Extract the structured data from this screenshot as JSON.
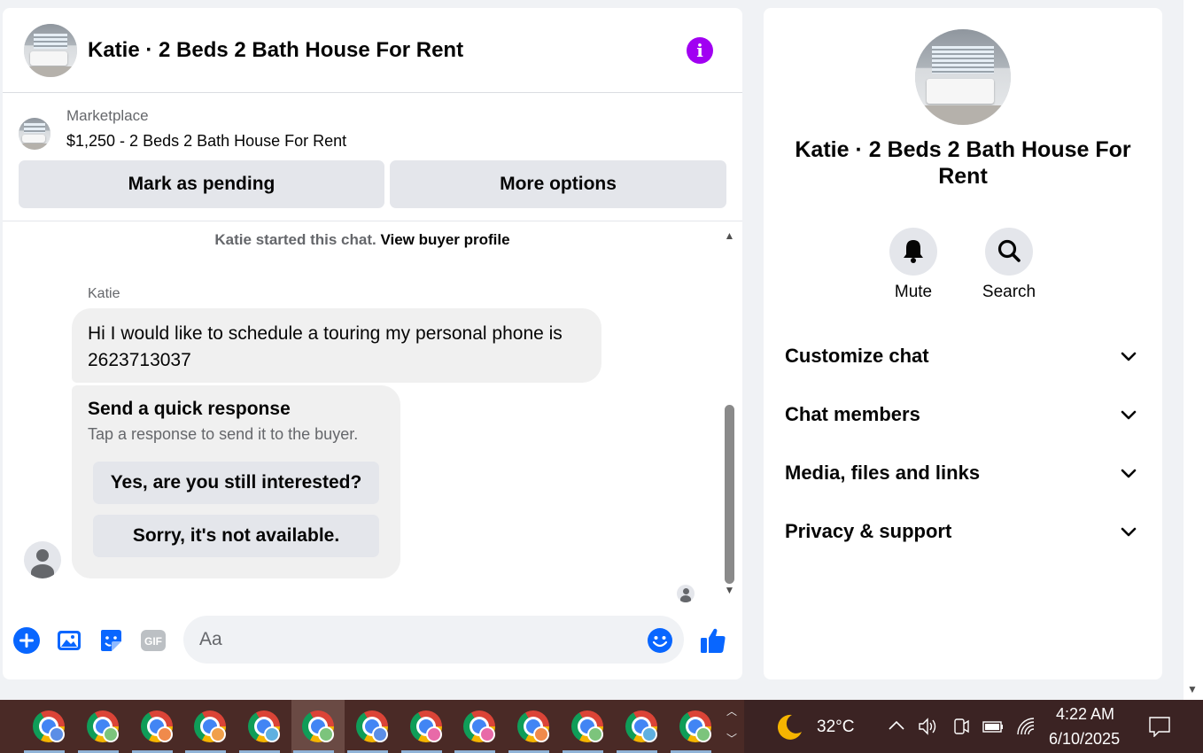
{
  "chat": {
    "header_title": "Katie · 2 Beds 2 Bath House For Rent",
    "info_glyph": "i",
    "listing": {
      "label": "Marketplace",
      "price_title": "$1,250 - 2 Beds 2 Bath House For Rent",
      "mark_pending": "Mark as pending",
      "more_options": "More options"
    },
    "system_text": "Katie started this chat.",
    "system_link": "View buyer profile",
    "sender": "Katie",
    "message": "Hi I would like to schedule a touring my personal phone is 2623713037",
    "quick_response": {
      "title": "Send a quick response",
      "subtitle": "Tap a response to send it to the buyer.",
      "options": [
        "Yes, are you still interested?",
        "Sorry, it's not available."
      ]
    },
    "composer": {
      "placeholder": "Aa",
      "gif_label": "GIF"
    }
  },
  "info": {
    "title": "Katie · 2 Beds 2 Bath House For Rent",
    "actions": [
      {
        "icon": "bell-icon",
        "label": "Mute"
      },
      {
        "icon": "search-icon",
        "label": "Search"
      }
    ],
    "sections": [
      "Customize chat",
      "Chat members",
      "Media, files and links",
      "Privacy & support"
    ]
  },
  "colors": {
    "accent_blue": "#0866ff",
    "info_purple": "#a100f2",
    "bubble_gray": "#f0f0f0",
    "button_gray": "#e4e6eb"
  },
  "taskbar": {
    "weather_icon": "moon-icon",
    "temperature": "32°C",
    "time": "4:22 AM",
    "date": "6/10/2025",
    "profile_colors": [
      "#5b8ee6",
      "#7cc47c",
      "#f08a4b",
      "#f0a04b",
      "#5fb0e0",
      "#7cc47c",
      "#5b8ee6",
      "#e86aa8",
      "#e86aa8",
      "#f08a4b",
      "#7cc47c",
      "#5fb0e0",
      "#7cc47c"
    ]
  }
}
